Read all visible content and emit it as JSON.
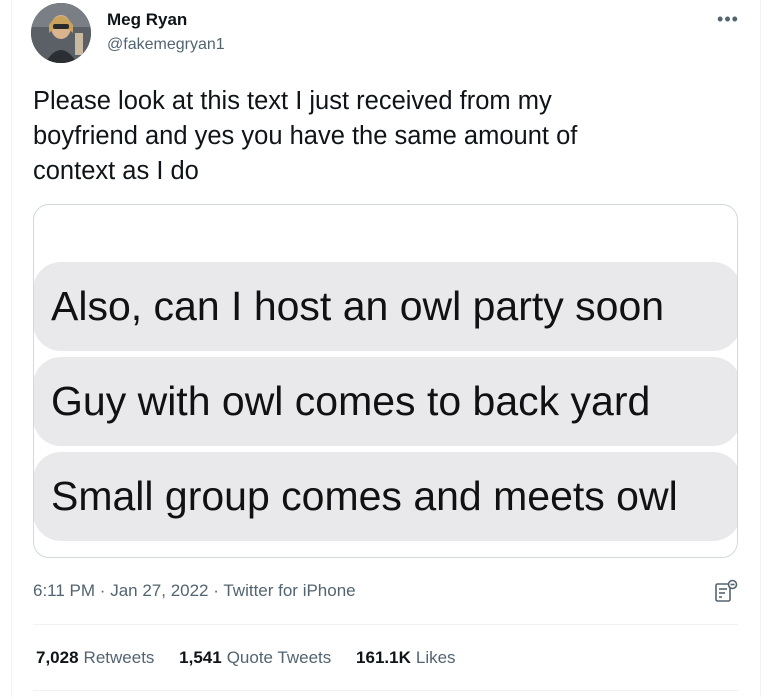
{
  "author": {
    "name": "Meg Ryan",
    "handle": "@fakemegryan1"
  },
  "more_icon": "more-horizontal-icon",
  "tweet": {
    "text": "Please look at this text I just received from my\nboyfriend and yes you have the same amount of\ncontext as I do"
  },
  "media": {
    "messages": [
      "Also, can I host an owl party soon",
      "Guy with owl comes to back yard",
      "Small group comes and meets owl"
    ]
  },
  "meta": {
    "time": "6:11 PM",
    "separator": "·",
    "date": "Jan 27, 2022",
    "source": "Twitter for iPhone"
  },
  "stats": {
    "retweets_count": "7,028",
    "retweets_label": "Retweets",
    "quotes_count": "1,541",
    "quotes_label": "Quote Tweets",
    "likes_count": "161.1K",
    "likes_label": "Likes"
  },
  "colors": {
    "text_primary": "#0f1419",
    "text_secondary": "#536471",
    "bubble_background": "#e9e9eb",
    "border": "#cfd9de",
    "divider": "#eff3f4"
  }
}
